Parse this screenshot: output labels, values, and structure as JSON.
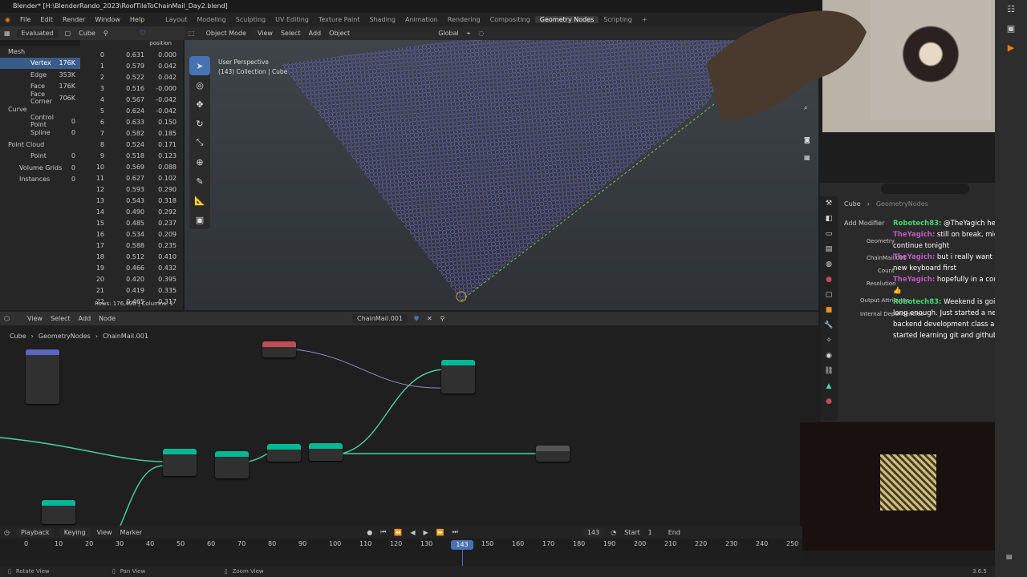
{
  "window": {
    "title": "Blender* [H:\\BlenderRando_2023\\RoofTileToChainMail_Day2.blend]"
  },
  "menu": [
    "File",
    "Edit",
    "Render",
    "Window",
    "Help"
  ],
  "workspaces": [
    "Layout",
    "Modeling",
    "Sculpting",
    "UV Editing",
    "Texture Paint",
    "Shading",
    "Animation",
    "Rendering",
    "Compositing",
    "Geometry Nodes",
    "Scripting"
  ],
  "ws_plus": "+",
  "spreadsheet": {
    "mode": "Evaluated",
    "object": "Cube",
    "col_header": "position",
    "tree": [
      {
        "label": "Mesh",
        "count": ""
      },
      {
        "label": "Vertex",
        "count": "176K"
      },
      {
        "label": "Edge",
        "count": "353K"
      },
      {
        "label": "Face",
        "count": "176K"
      },
      {
        "label": "Face Corner",
        "count": "706K"
      },
      {
        "label": "Curve",
        "count": ""
      },
      {
        "label": "Control Point",
        "count": "0"
      },
      {
        "label": "Spline",
        "count": "0"
      },
      {
        "label": "Point Cloud",
        "count": ""
      },
      {
        "label": "Point",
        "count": "0"
      },
      {
        "label": "Volume Grids",
        "count": "0"
      },
      {
        "label": "Instances",
        "count": "0"
      }
    ],
    "rows": [
      [
        "0",
        "0.631",
        "0.000"
      ],
      [
        "1",
        "0.579",
        "0.042"
      ],
      [
        "2",
        "0.522",
        "0.042"
      ],
      [
        "3",
        "0.516",
        "-0.000"
      ],
      [
        "4",
        "0.567",
        "-0.042"
      ],
      [
        "5",
        "0.624",
        "-0.042"
      ],
      [
        "6",
        "0.633",
        "0.150"
      ],
      [
        "7",
        "0.582",
        "0.185"
      ],
      [
        "8",
        "0.524",
        "0.171"
      ],
      [
        "9",
        "0.518",
        "0.123"
      ],
      [
        "10",
        "0.569",
        "0.088"
      ],
      [
        "11",
        "0.627",
        "0.102"
      ],
      [
        "12",
        "0.593",
        "0.290"
      ],
      [
        "13",
        "0.543",
        "0.318"
      ],
      [
        "14",
        "0.490",
        "0.292"
      ],
      [
        "15",
        "0.485",
        "0.237"
      ],
      [
        "16",
        "0.534",
        "0.209"
      ],
      [
        "17",
        "0.588",
        "0.235"
      ],
      [
        "18",
        "0.512",
        "0.410"
      ],
      [
        "19",
        "0.466",
        "0.432"
      ],
      [
        "20",
        "0.420",
        "0.395"
      ],
      [
        "21",
        "0.419",
        "0.335"
      ],
      [
        "22",
        "0.465",
        "0.317"
      ]
    ],
    "footer": "Rows: 176,400  |  Columns: 1"
  },
  "viewport": {
    "mode": "Object Mode",
    "menus": [
      "View",
      "Select",
      "Add",
      "Object"
    ],
    "orientation": "Global",
    "label1": "User Perspective",
    "label2": "(143) Collection | Cube"
  },
  "node_editor": {
    "menus": [
      "View",
      "Select",
      "Add",
      "Node"
    ],
    "tree_name": "ChainMail.001",
    "breadcrumb": [
      "Cube",
      "GeometryNodes",
      "ChainMail.001"
    ]
  },
  "properties": {
    "object": "Cube",
    "modifier": "GeometryNodes",
    "add_modifier": "Add Modifier",
    "fields": [
      "Geometry",
      "ChainMail.001",
      "Count",
      "Resolution"
    ],
    "sections": [
      "Output Attributes",
      "Internal Dependencies"
    ]
  },
  "chat": [
    {
      "user": "Robotech83:",
      "msg": "@TheYagich hello",
      "cls": "u1"
    },
    {
      "user": "TheYagich:",
      "msg": "still on break, might continue tonight",
      "cls": "u2"
    },
    {
      "user": "TheYagich:",
      "msg": "but i really want to get my new keyboard first",
      "cls": "u2"
    },
    {
      "user": "TheYagich:",
      "msg": "hopefully in a couple days 👍",
      "cls": "u2"
    },
    {
      "user": "Robotech83:",
      "msg": "Weekend is going. It isn't long enough. Just started a new backend development class and started learning git and github",
      "cls": "u1"
    }
  ],
  "timeline": {
    "menus": [
      "Playback",
      "Keying",
      "View",
      "Marker"
    ],
    "current": "143",
    "start_label": "Start",
    "start": "1",
    "end_label": "End",
    "ticks": [
      "0",
      "10",
      "20",
      "30",
      "40",
      "50",
      "60",
      "70",
      "80",
      "90",
      "100",
      "110",
      "120",
      "130",
      "140",
      "150",
      "160",
      "170",
      "180",
      "190",
      "200",
      "210",
      "220",
      "230",
      "240",
      "250"
    ]
  },
  "status": {
    "items": [
      "Rotate View",
      "Pan View",
      "Zoom View"
    ],
    "version": "3.6.5"
  },
  "colors": {
    "accent": "#4772b3",
    "node_geo": "#00b894",
    "node_input": "#c04c55"
  }
}
